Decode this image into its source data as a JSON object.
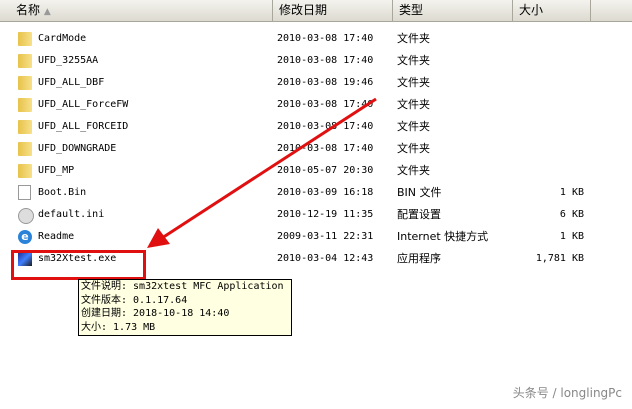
{
  "header": {
    "name": "名称",
    "date": "修改日期",
    "type": "类型",
    "size": "大小"
  },
  "files": [
    {
      "name": "CardMode",
      "date": "2010-03-08 17:40",
      "type": "文件夹",
      "size": "",
      "icon": "folder-icon"
    },
    {
      "name": "UFD_3255AA",
      "date": "2010-03-08 17:40",
      "type": "文件夹",
      "size": "",
      "icon": "folder-icon"
    },
    {
      "name": "UFD_ALL_DBF",
      "date": "2010-03-08 19:46",
      "type": "文件夹",
      "size": "",
      "icon": "folder-icon"
    },
    {
      "name": "UFD_ALL_ForceFW",
      "date": "2010-03-08 17:40",
      "type": "文件夹",
      "size": "",
      "icon": "folder-icon"
    },
    {
      "name": "UFD_ALL_FORCEID",
      "date": "2010-03-08 17:40",
      "type": "文件夹",
      "size": "",
      "icon": "folder-icon"
    },
    {
      "name": "UFD_DOWNGRADE",
      "date": "2010-03-08 17:40",
      "type": "文件夹",
      "size": "",
      "icon": "folder-icon"
    },
    {
      "name": "UFD_MP",
      "date": "2010-05-07 20:30",
      "type": "文件夹",
      "size": "",
      "icon": "folder-icon"
    },
    {
      "name": "Boot.Bin",
      "date": "2010-03-09 16:18",
      "type": "BIN 文件",
      "size": "1 KB",
      "icon": "file-icon"
    },
    {
      "name": "default.ini",
      "date": "2010-12-19 11:35",
      "type": "配置设置",
      "size": "6 KB",
      "icon": "settings-file-icon"
    },
    {
      "name": "Readme",
      "date": "2009-03-11 22:31",
      "type": "Internet 快捷方式",
      "size": "1 KB",
      "icon": "ie-shortcut-icon"
    },
    {
      "name": "sm32Xtest.exe",
      "date": "2010-03-04 12:43",
      "type": "应用程序",
      "size": "1,781 KB",
      "icon": "exe-icon"
    }
  ],
  "tooltip": [
    "文件说明: sm32xtest MFC Application",
    "文件版本: 0.1.17.64",
    "创建日期: 2018-10-18 14:40",
    "大小: 1.73 MB"
  ],
  "watermark": "头条号 / longlingPc"
}
